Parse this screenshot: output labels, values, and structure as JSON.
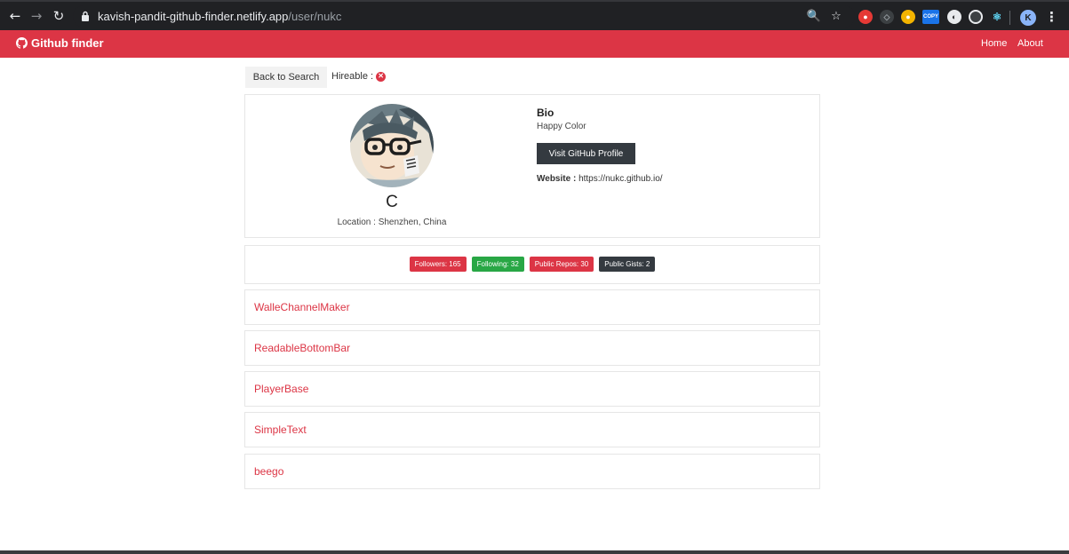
{
  "browser": {
    "url_host": "kavish-pandit-github-finder.netlify.app",
    "url_path": "/user/nukc",
    "profile_initial": "K",
    "extension_copy_label": "COPY"
  },
  "navbar": {
    "brand": "Github finder",
    "links": [
      "Home",
      "About"
    ]
  },
  "actions": {
    "back_label": "Back to Search",
    "hireable_label": "Hireable :"
  },
  "profile": {
    "name": "C",
    "location": "Location : Shenzhen, China",
    "bio_title": "Bio",
    "bio": "Happy Color",
    "visit_label": "Visit GitHub Profile",
    "website_label": "Website :",
    "website_url": "https://nukc.github.io/"
  },
  "stats": [
    {
      "label": "Followers: 165",
      "color": "#dc3545"
    },
    {
      "label": "Following: 32",
      "color": "#28a745"
    },
    {
      "label": "Public Repos: 30",
      "color": "#dc3545"
    },
    {
      "label": "Public Gists: 2",
      "color": "#343a40"
    }
  ],
  "repos": [
    "WalleChannelMaker",
    "ReadableBottomBar",
    "PlayerBase",
    "SimpleText",
    "beego"
  ],
  "colors": {
    "accent": "#dc3545",
    "dark": "#343a40",
    "success": "#28a745"
  }
}
